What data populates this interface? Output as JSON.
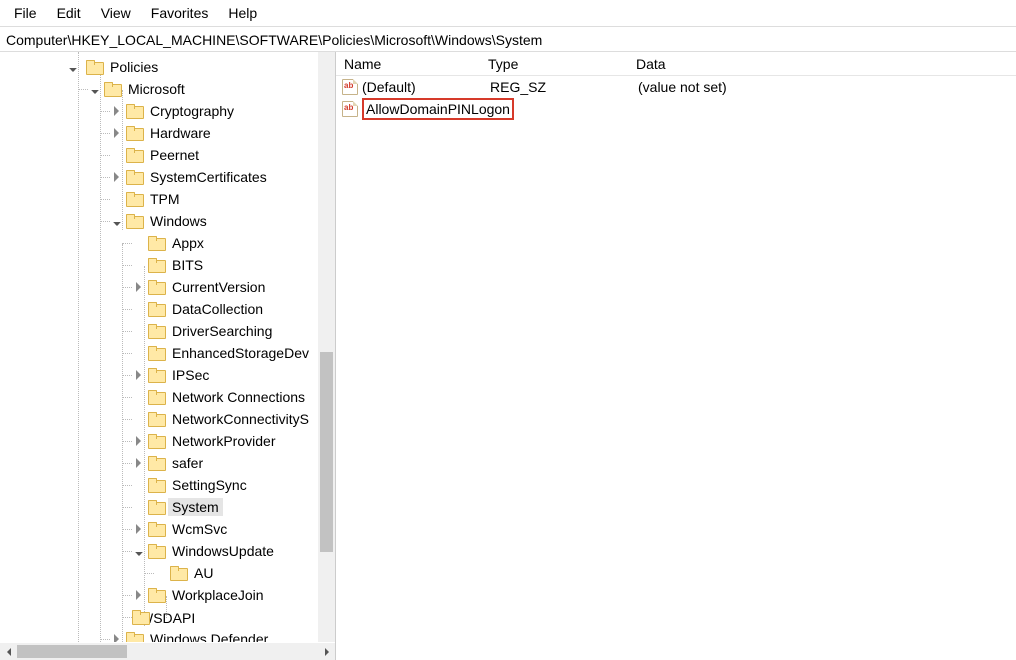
{
  "menubar": {
    "file": "File",
    "edit": "Edit",
    "view": "View",
    "favorites": "Favorites",
    "help": "Help"
  },
  "address_path": "Computer\\HKEY_LOCAL_MACHINE\\SOFTWARE\\Policies\\Microsoft\\Windows\\System",
  "tree": {
    "policies": "Policies",
    "microsoft": "Microsoft",
    "cryptography": "Cryptography",
    "hardware": "Hardware",
    "peernet": "Peernet",
    "systemcertificates": "SystemCertificates",
    "tpm": "TPM",
    "windows": "Windows",
    "appx": "Appx",
    "bits": "BITS",
    "currentversion": "CurrentVersion",
    "datacollection": "DataCollection",
    "driversearching": "DriverSearching",
    "enhancedstoragedev": "EnhancedStorageDev",
    "ipsec": "IPSec",
    "networkconnections": "Network Connections",
    "networkconnectivity": "NetworkConnectivityS",
    "networkprovider": "NetworkProvider",
    "safer": "safer",
    "settingsync": "SettingSync",
    "system": "System",
    "wcmsvc": "WcmSvc",
    "windowsupdate": "WindowsUpdate",
    "au": "AU",
    "workplacejoin": "WorkplaceJoin",
    "wsdapi": "WSDAPI",
    "windowsdefender": "Windows Defender"
  },
  "list": {
    "headers": {
      "name": "Name",
      "type": "Type",
      "data": "Data"
    },
    "rows": [
      {
        "name": "(Default)",
        "type": "REG_SZ",
        "data": "(value not set)"
      },
      {
        "name": "AllowDomainPINLogon",
        "type": "",
        "data": ""
      }
    ]
  }
}
